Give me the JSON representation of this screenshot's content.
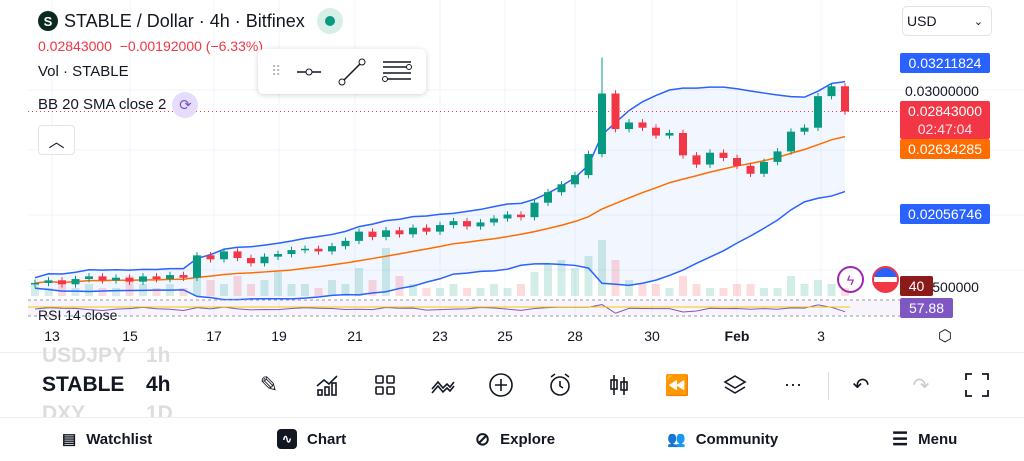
{
  "header": {
    "title": "STABLE / Dollar · 4h · Bitfinex",
    "logo_letter": "S",
    "price": "0.02843000",
    "change": "−0.00192000 (−6.33%)"
  },
  "legend": {
    "volume": "Vol · STABLE",
    "bb": "BB 20 SMA close 2",
    "rsi": "RSI 14 close"
  },
  "currency": "USD",
  "price_axis": {
    "upper_band": "0.03211824",
    "level_030": "0.03000000",
    "last_price": "0.02843000",
    "countdown": "02:47:04",
    "basis": "0.02634285",
    "lower_band": "0.02056746",
    "vol_axis": "0.01500000",
    "vol_badge": "40",
    "rsi_value": "57.88"
  },
  "colors": {
    "up": "#089981",
    "down": "#f23645",
    "band": "#2962ff",
    "basis": "#ff6d00",
    "rsi": "#7e57c2"
  },
  "time_axis": [
    "13",
    "15",
    "17",
    "19",
    "21",
    "23",
    "25",
    "28",
    "30",
    "Feb",
    "3"
  ],
  "symbol_picker": {
    "prev": "USDJPY",
    "prev_tf": "1h",
    "current": "STABLE",
    "current_tf": "4h",
    "next": "DXY",
    "next_tf": "1D"
  },
  "nav": {
    "watchlist": "Watchlist",
    "chart": "Chart",
    "explore": "Explore",
    "community": "Community",
    "menu": "Menu"
  },
  "ohlc_closes_milli": [
    15.4,
    15.6,
    15.3,
    15.7,
    15.9,
    15.6,
    15.8,
    15.5,
    15.9,
    15.7,
    16.0,
    15.8,
    17.5,
    17.2,
    17.8,
    17.3,
    16.9,
    17.4,
    17.6,
    17.9,
    18.0,
    17.8,
    18.2,
    18.6,
    19.3,
    18.9,
    19.4,
    19.1,
    19.6,
    19.3,
    19.8,
    20.1,
    19.7,
    20.0,
    20.3,
    20.6,
    20.4,
    21.5,
    22.3,
    22.9,
    23.6,
    25.2,
    29.8,
    27.1,
    27.6,
    27.2,
    26.6,
    26.8,
    25.1,
    24.4,
    25.3,
    24.9,
    24.3,
    23.7,
    24.6,
    25.4,
    26.9,
    27.2,
    29.6,
    30.35,
    28.43
  ],
  "volumes": [
    3,
    2,
    4,
    2,
    3,
    2,
    2,
    5,
    3,
    2,
    3,
    2,
    9,
    4,
    3,
    5,
    3,
    4,
    6,
    3,
    3,
    2,
    4,
    3,
    7,
    4,
    12,
    5,
    3,
    2,
    2,
    3,
    2,
    2,
    3,
    2,
    3,
    6,
    8,
    9,
    7,
    10,
    14,
    9,
    4,
    3,
    3,
    2,
    5,
    3,
    2,
    2,
    3,
    3,
    2,
    2,
    5,
    3,
    4,
    3,
    2
  ]
}
